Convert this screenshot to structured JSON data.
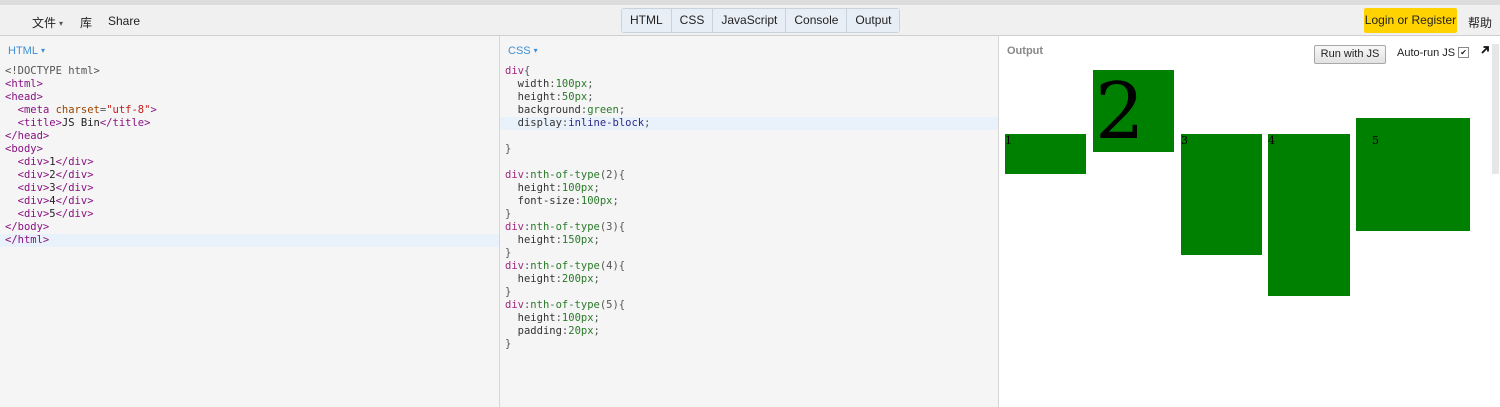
{
  "toolbar": {
    "file_menu": "文件",
    "library": "库",
    "share": "Share",
    "panels": [
      "HTML",
      "CSS",
      "JavaScript",
      "Console",
      "Output"
    ],
    "login": "Login or Register",
    "help": "帮助"
  },
  "html_panel": {
    "label": "HTML"
  },
  "css_panel": {
    "label": "CSS"
  },
  "output_panel": {
    "label": "Output",
    "run_button": "Run with JS",
    "autorun_label": "Auto-run JS",
    "autorun_checked": true,
    "boxes": [
      "1",
      "2",
      "3",
      "4",
      "5"
    ]
  },
  "colors": {
    "box_green": "#008000",
    "login_yellow": "#ffd200",
    "panel_label_blue": "#3d8fd6"
  }
}
